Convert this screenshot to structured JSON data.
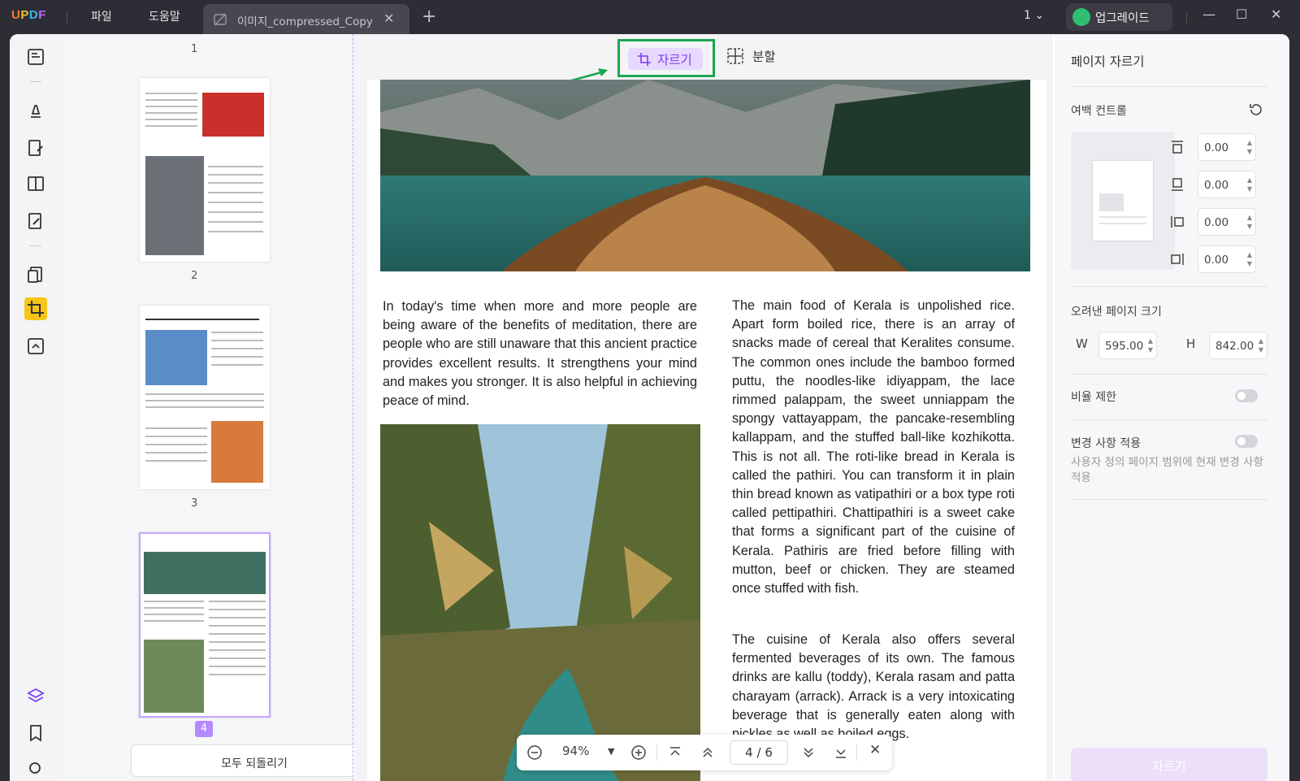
{
  "app": {
    "logo": "UPDF",
    "menu": [
      "파일",
      "도움말"
    ],
    "tab_title": "이미지_compressed_Copy",
    "page_selector": "1",
    "upgrade_label": "업그레이드"
  },
  "colors": {
    "accent": "#7b3ff2",
    "highlight_box": "#1ca64f",
    "tool_active": "#f5c518"
  },
  "toolbar": {
    "crop_label": "자르기",
    "split_label": "분할"
  },
  "thumbnails": {
    "page_numbers": [
      "1",
      "2",
      "3",
      "4"
    ],
    "current": "4",
    "restore_all_label": "모두 되돌리기"
  },
  "document": {
    "left_paragraph": "In today's time when more and more people are being aware of the benefits of meditation, there are people who are still unaware that this ancient practice provides excellent results. It strengthens your mind and makes you stronger. It is also helpful in achieving peace of mind.",
    "right_paragraph_1": "The main food of Kerala is unpolished rice. Apart form boiled rice, there is an array of snacks made of cereal that Keralites consume. The common ones include the bamboo formed puttu, the noodles-like idiyappam, the lace rimmed palappam, the sweet unniappam the spongy vattayappam, the pancake-resembling kallappam, and the stuffed ball-like kozhikotta. This is not all. The roti-like bread in Kerala is called the pathiri. You can transform it in plain thin bread known as vatipathiri or a box type roti called pettipathiri. Chattipathiri is a sweet cake that forms a significant part of the cuisine of Kerala. Pathiris are fried before filling with mutton, beef or chicken. They are steamed once stuffed with fish.",
    "right_paragraph_2": "The cuisine of Kerala also offers several fermented beverages of its own. The famous drinks are kallu (toddy), Kerala rasam and patta charayam (arrack). Arrack is a very intoxicating beverage that is generally eaten along with pickles as well as boiled eggs."
  },
  "zoom": {
    "level": "94%",
    "current_page": "4",
    "separator": "/",
    "total_pages": "6"
  },
  "crop_panel": {
    "title": "페이지 자르기",
    "margin_control_label": "여백 컨트롤",
    "margins": {
      "top": "0.00",
      "bottom": "0.00",
      "left": "0.00",
      "right": "0.00"
    },
    "cropped_size_label": "오려낸 페이지 크기",
    "width_label": "W",
    "width": "595.00",
    "height_label": "H",
    "height": "842.00",
    "ratio_label": "비율 제한",
    "apply_label": "변경 사항 적용",
    "apply_desc": "사용자 정의 페이지 범위에 현재 변경 사항 적용",
    "crop_button": "자르기"
  }
}
